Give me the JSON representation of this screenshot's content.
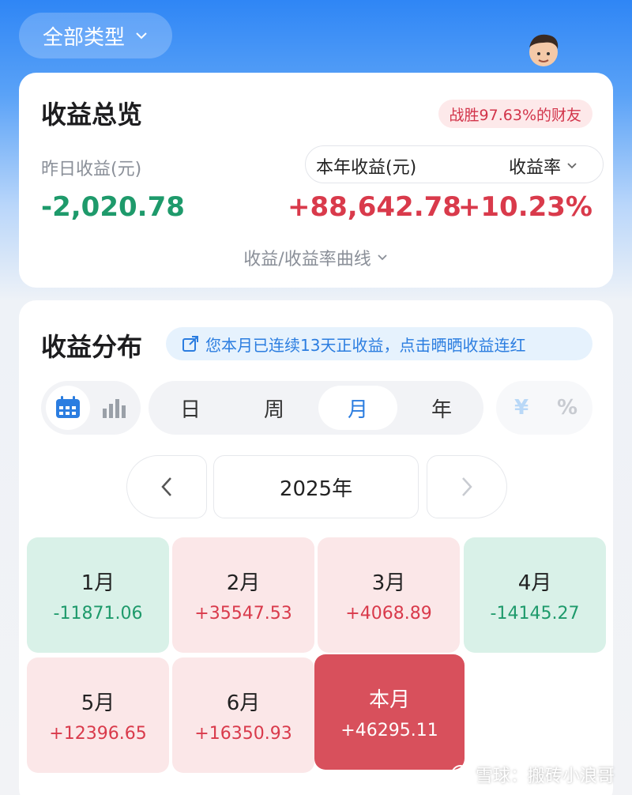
{
  "filter": {
    "label": "全部类型"
  },
  "overview": {
    "title": "收益总览",
    "rank_badge": "战胜97.63%的财友",
    "yesterday_label": "昨日收益(元)",
    "yesterday_value": "-2,020.78",
    "year_label": "本年收益(元)",
    "year_value": "+88,642.78",
    "rate_label": "收益率",
    "rate_value": "+10.23%",
    "curve_toggle": "收益/收益率曲线"
  },
  "distribution": {
    "title": "收益分布",
    "streak_text": "您本月已连续13天正收益，点击晒晒收益连红",
    "periods": [
      "日",
      "周",
      "月",
      "年"
    ],
    "active_period": "月",
    "units": {
      "yuan": "¥",
      "percent": "%"
    },
    "year_display": "2025年",
    "months": [
      {
        "name": "1月",
        "value": "-11871.06",
        "sign": "neg"
      },
      {
        "name": "2月",
        "value": "+35547.53",
        "sign": "pos"
      },
      {
        "name": "3月",
        "value": "+4068.89",
        "sign": "pos"
      },
      {
        "name": "4月",
        "value": "-14145.27",
        "sign": "neg"
      },
      {
        "name": "5月",
        "value": "+12396.65",
        "sign": "pos"
      },
      {
        "name": "6月",
        "value": "+16350.93",
        "sign": "pos"
      },
      {
        "name": "本月",
        "value": "+46295.11",
        "sign": "cur"
      }
    ]
  },
  "watermark": "雪球：搬砖小浪哥",
  "colors": {
    "negative": "#1e9a6b",
    "positive": "#d93a4b",
    "accent": "#2b7de0",
    "current_month": "#d8505c"
  }
}
